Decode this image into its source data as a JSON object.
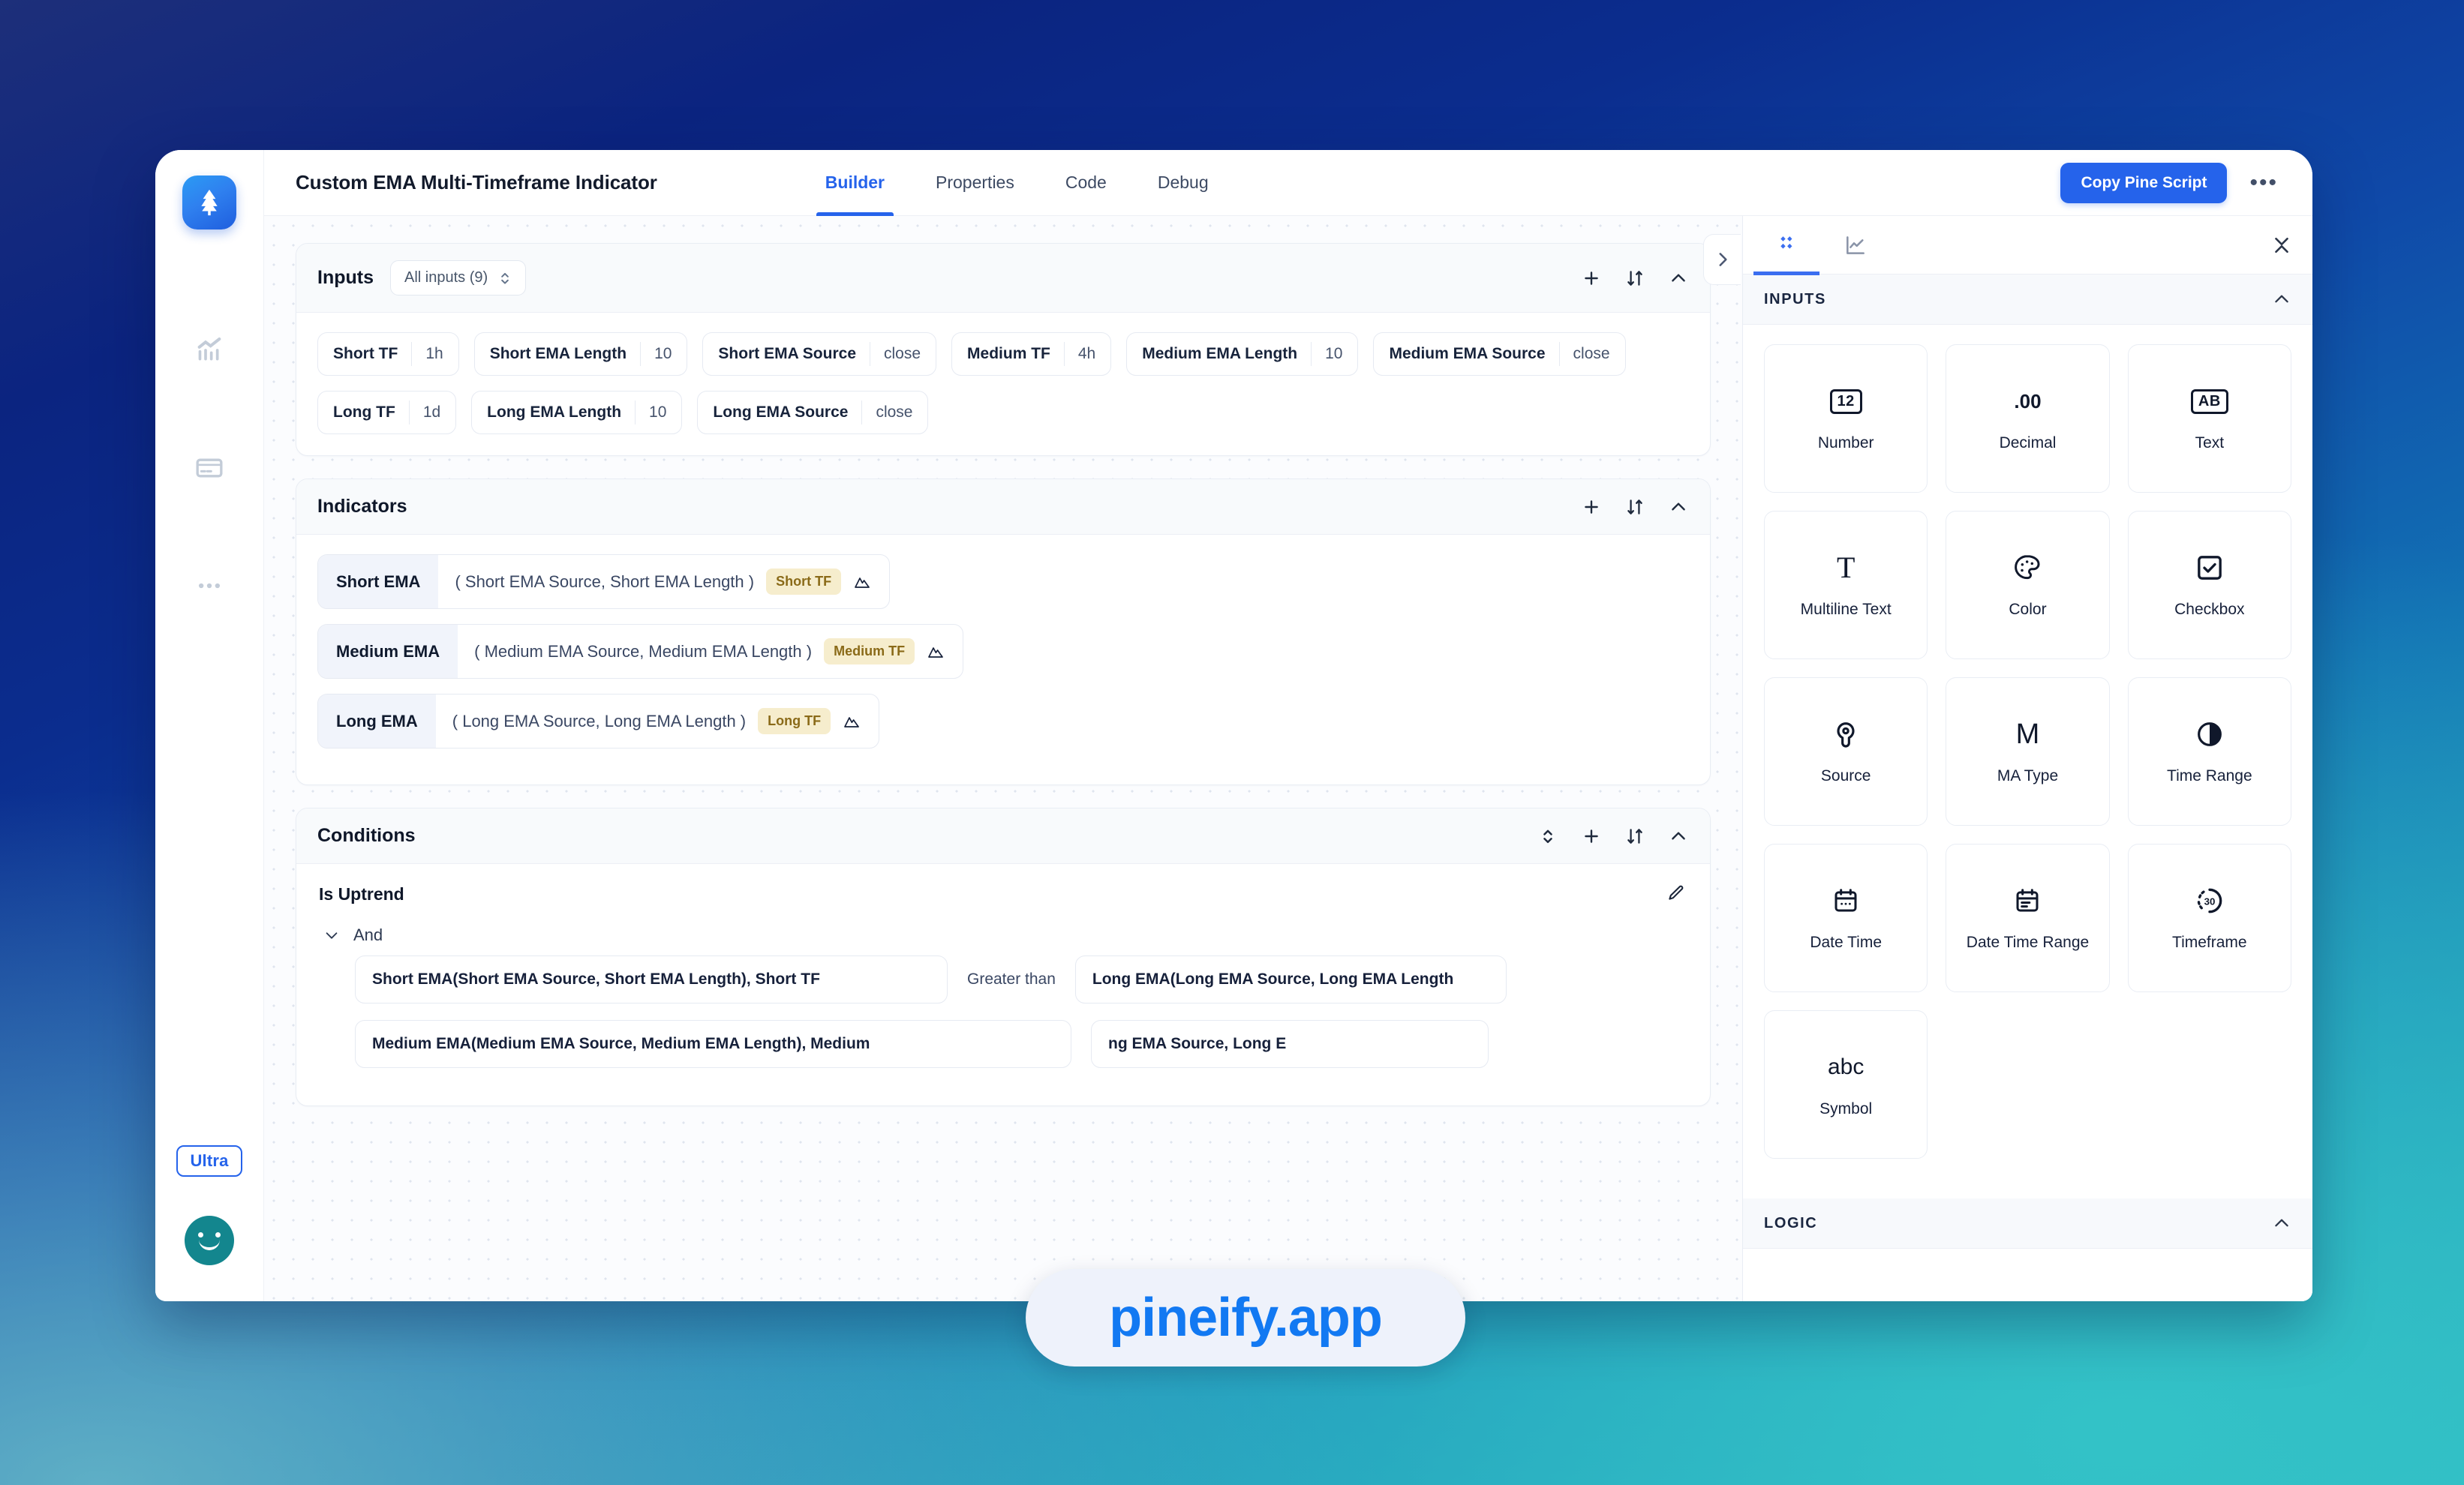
{
  "app": {
    "logo_icon": "pine-tree-logo-icon",
    "rail_icons": [
      "chart-bars-icon",
      "credit-card-icon",
      "more-dots-icon"
    ],
    "plan_badge": "Ultra",
    "avatar": "user-avatar"
  },
  "topbar": {
    "title": "Custom EMA Multi-Timeframe Indicator",
    "tabs": [
      {
        "label": "Builder",
        "active": true
      },
      {
        "label": "Properties",
        "active": false
      },
      {
        "label": "Code",
        "active": false
      },
      {
        "label": "Debug",
        "active": false
      }
    ],
    "primary_button": "Copy Pine Script",
    "kebab_icon": "more-horizontal-icon"
  },
  "inputs_panel": {
    "title": "Inputs",
    "filter_label": "All inputs (9)",
    "actions": [
      "add-icon",
      "sort-icon",
      "collapse-icon"
    ],
    "chips": [
      {
        "key": "Short TF",
        "value": "1h"
      },
      {
        "key": "Short EMA Length",
        "value": "10"
      },
      {
        "key": "Short EMA Source",
        "value": "close"
      },
      {
        "key": "Medium TF",
        "value": "4h"
      },
      {
        "key": "Medium EMA Length",
        "value": "10"
      },
      {
        "key": "Medium EMA Source",
        "value": "close"
      },
      {
        "key": "Long TF",
        "value": "1d"
      },
      {
        "key": "Long EMA Length",
        "value": "10"
      },
      {
        "key": "Long EMA Source",
        "value": "close"
      }
    ]
  },
  "indicators_panel": {
    "title": "Indicators",
    "actions": [
      "add-icon",
      "sort-icon",
      "collapse-icon"
    ],
    "rows": [
      {
        "name": "Short EMA",
        "args": "( Short EMA Source, Short EMA Length )",
        "tf_tag": "Short TF"
      },
      {
        "name": "Medium EMA",
        "args": "( Medium EMA Source, Medium EMA Length )",
        "tf_tag": "Medium TF"
      },
      {
        "name": "Long EMA",
        "args": "( Long EMA Source, Long EMA Length )",
        "tf_tag": "Long TF"
      }
    ]
  },
  "conditions_panel": {
    "title": "Conditions",
    "actions": [
      "expand-collapse-icon",
      "add-icon",
      "sort-icon",
      "collapse-icon"
    ],
    "group_title": "Is Uptrend",
    "edit_icon": "pencil-icon",
    "operator_group": "And",
    "comparisons": [
      {
        "left": "Short EMA(Short EMA Source, Short EMA Length), Short TF",
        "operator": "Greater than",
        "right": "Long EMA(Long EMA Source, Long EMA Length"
      },
      {
        "left": "Medium EMA(Medium EMA Source, Medium EMA Length), Medium",
        "operator": "",
        "right": "ng EMA Source, Long E"
      }
    ]
  },
  "right_panel": {
    "collapse_tab_icon": "chevron-right-icon",
    "tabs": [
      {
        "icon": "blocks-diamond-icon",
        "active": true
      },
      {
        "icon": "line-chart-icon",
        "active": false
      }
    ],
    "collapse_all_icon": "collapse-vertical-icon",
    "sections": [
      {
        "title": "INPUTS",
        "chevron": "chevron-up-icon",
        "cards": [
          {
            "label": "Number",
            "icon": "number-12-box-icon",
            "glyph": "12"
          },
          {
            "label": "Decimal",
            "icon": "decimal-point-icon",
            "glyph": ".00"
          },
          {
            "label": "Text",
            "icon": "text-ab-box-icon",
            "glyph": "AB"
          },
          {
            "label": "Multiline Text",
            "icon": "multiline-text-t-icon",
            "glyph": "T"
          },
          {
            "label": "Color",
            "icon": "color-palette-icon",
            "glyph": ""
          },
          {
            "label": "Checkbox",
            "icon": "checkbox-checked-icon",
            "glyph": ""
          },
          {
            "label": "Source",
            "icon": "source-pin-icon",
            "glyph": ""
          },
          {
            "label": "MA Type",
            "icon": "ma-type-m-icon",
            "glyph": "M"
          },
          {
            "label": "Time Range",
            "icon": "time-range-clock-icon",
            "glyph": ""
          },
          {
            "label": "Date Time",
            "icon": "calendar-icon",
            "glyph": ""
          },
          {
            "label": "Date Time Range",
            "icon": "calendar-range-icon",
            "glyph": ""
          },
          {
            "label": "Timeframe",
            "icon": "timeframe-30-icon",
            "glyph": "30"
          },
          {
            "label": "Symbol",
            "icon": "symbol-abc-icon",
            "glyph": "abc"
          }
        ]
      },
      {
        "title": "LOGIC",
        "chevron": "chevron-up-icon",
        "cards": []
      }
    ]
  },
  "watermark": {
    "text": "pineify.app"
  },
  "colors": {
    "accent": "#2563eb",
    "panel_border": "#e9edf4",
    "tf_tag_bg": "#f6edcd",
    "tf_tag_text": "#8a6a18",
    "avatar": "#13868e",
    "watermark_text": "#1279f2"
  }
}
